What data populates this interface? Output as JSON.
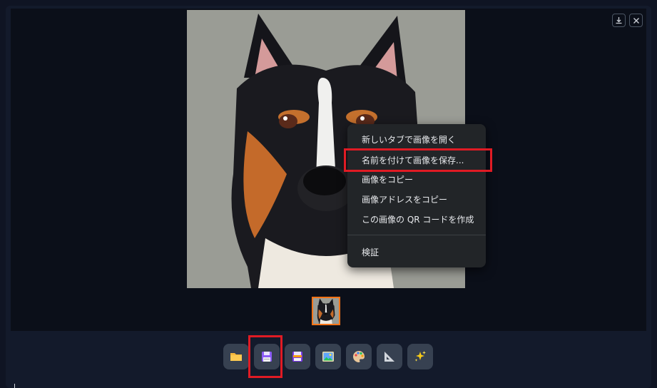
{
  "context_menu": {
    "items": [
      "新しいタブで画像を開く",
      "名前を付けて画像を保存...",
      "画像をコピー",
      "画像アドレスをコピー",
      "この画像の QR コードを作成",
      "検証"
    ]
  },
  "gallery": {
    "image_subject": "dog",
    "actions": [
      "download-icon",
      "close-icon"
    ]
  },
  "toolbar": {
    "icons": [
      "folder-icon",
      "save-icon",
      "zip-save-icon",
      "send-to-img2img-icon",
      "palette-icon",
      "triangle-ruler-icon",
      "sparkles-icon"
    ]
  },
  "colors": {
    "highlight": "#e01b24",
    "selected_thumb": "#f97316",
    "menu_bg": "#222528"
  }
}
